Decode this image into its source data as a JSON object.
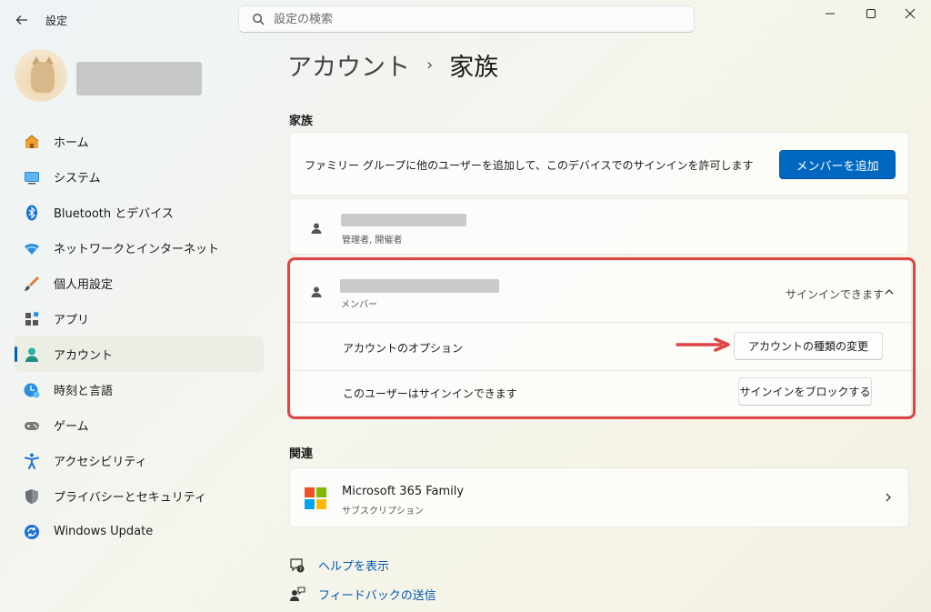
{
  "window": {
    "title": "設定",
    "search_placeholder": "設定の検索",
    "minimize": "—",
    "maximize": "☐",
    "close": "✕"
  },
  "sidebar": {
    "items": [
      {
        "label": "ホーム",
        "icon": "home-icon"
      },
      {
        "label": "システム",
        "icon": "system-icon"
      },
      {
        "label": "Bluetooth とデバイス",
        "icon": "bluetooth-icon"
      },
      {
        "label": "ネットワークとインターネット",
        "icon": "wifi-icon"
      },
      {
        "label": "個人用設定",
        "icon": "brush-icon"
      },
      {
        "label": "アプリ",
        "icon": "apps-icon"
      },
      {
        "label": "アカウント",
        "icon": "account-icon",
        "active": true
      },
      {
        "label": "時刻と言語",
        "icon": "clock-globe-icon"
      },
      {
        "label": "ゲーム",
        "icon": "gamepad-icon"
      },
      {
        "label": "アクセシビリティ",
        "icon": "accessibility-icon"
      },
      {
        "label": "プライバシーとセキュリティ",
        "icon": "shield-icon"
      },
      {
        "label": "Windows Update",
        "icon": "update-icon"
      }
    ]
  },
  "breadcrumb": {
    "parent": "アカウント",
    "separator": "›",
    "current": "家族"
  },
  "family": {
    "section_title": "家族",
    "intro_text": "ファミリー グループに他のユーザーを追加して、このデバイスでのサインインを許可します",
    "add_member_button": "メンバーを追加",
    "member1_role": "管理者, 開催者",
    "member2_role": "メンバー",
    "member2_status": "サインインできます",
    "account_options_label": "アカウントのオプション",
    "change_type_button": "アカウントの種類の変更",
    "signin_status_label": "このユーザーはサインインできます",
    "block_signin_button": "サインインをブロックする"
  },
  "related": {
    "section_title": "関連",
    "m365_title": "Microsoft 365 Family",
    "m365_subtitle": "サブスクリプション"
  },
  "links": {
    "help": "ヘルプを表示",
    "feedback": "フィードバックの送信"
  },
  "colors": {
    "accent": "#0067c0",
    "highlight": "#e04444",
    "link": "#0058b0"
  }
}
